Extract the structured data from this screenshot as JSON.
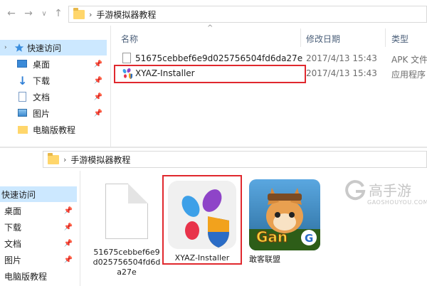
{
  "top": {
    "path": "手游模拟器教程",
    "columns": {
      "name": "名称",
      "date": "修改日期",
      "type": "类型"
    },
    "sidebar": [
      {
        "label": "快速访问",
        "icon": "star-icon",
        "pinned": false
      },
      {
        "label": "桌面",
        "icon": "desktop-icon",
        "pinned": true
      },
      {
        "label": "下载",
        "icon": "download-icon",
        "pinned": true
      },
      {
        "label": "文档",
        "icon": "document-icon",
        "pinned": true
      },
      {
        "label": "图片",
        "icon": "picture-icon",
        "pinned": true
      },
      {
        "label": "电脑版教程",
        "icon": "folder-icon",
        "pinned": false
      }
    ],
    "files": [
      {
        "name": "51675cebbef6e9d025756504fd6da27e",
        "date": "2017/4/13 15:43",
        "type": "APK 文件"
      },
      {
        "name": "XYAZ-Installer",
        "date": "2017/4/13 15:43",
        "type": "应用程序"
      }
    ]
  },
  "bottom": {
    "path": "手游模拟器教程",
    "sidebar": [
      {
        "label": "快速访问",
        "pinned": false
      },
      {
        "label": "桌面",
        "pinned": true
      },
      {
        "label": "下载",
        "pinned": true
      },
      {
        "label": "文档",
        "pinned": true
      },
      {
        "label": "图片",
        "pinned": true
      },
      {
        "label": "电脑版教程",
        "pinned": false
      }
    ],
    "tiles": [
      {
        "label": "51675cebbef6e9d025756504fd6da27e"
      },
      {
        "label": "XYAZ-Installer"
      },
      {
        "label": "敢客联盟"
      }
    ]
  },
  "watermark": {
    "brand": "高手游",
    "url": "GAOSHOUYOU.COM"
  },
  "colors": {
    "highlight": "#e0282e",
    "selected": "#cce8ff",
    "folder": "#ffd66b"
  }
}
